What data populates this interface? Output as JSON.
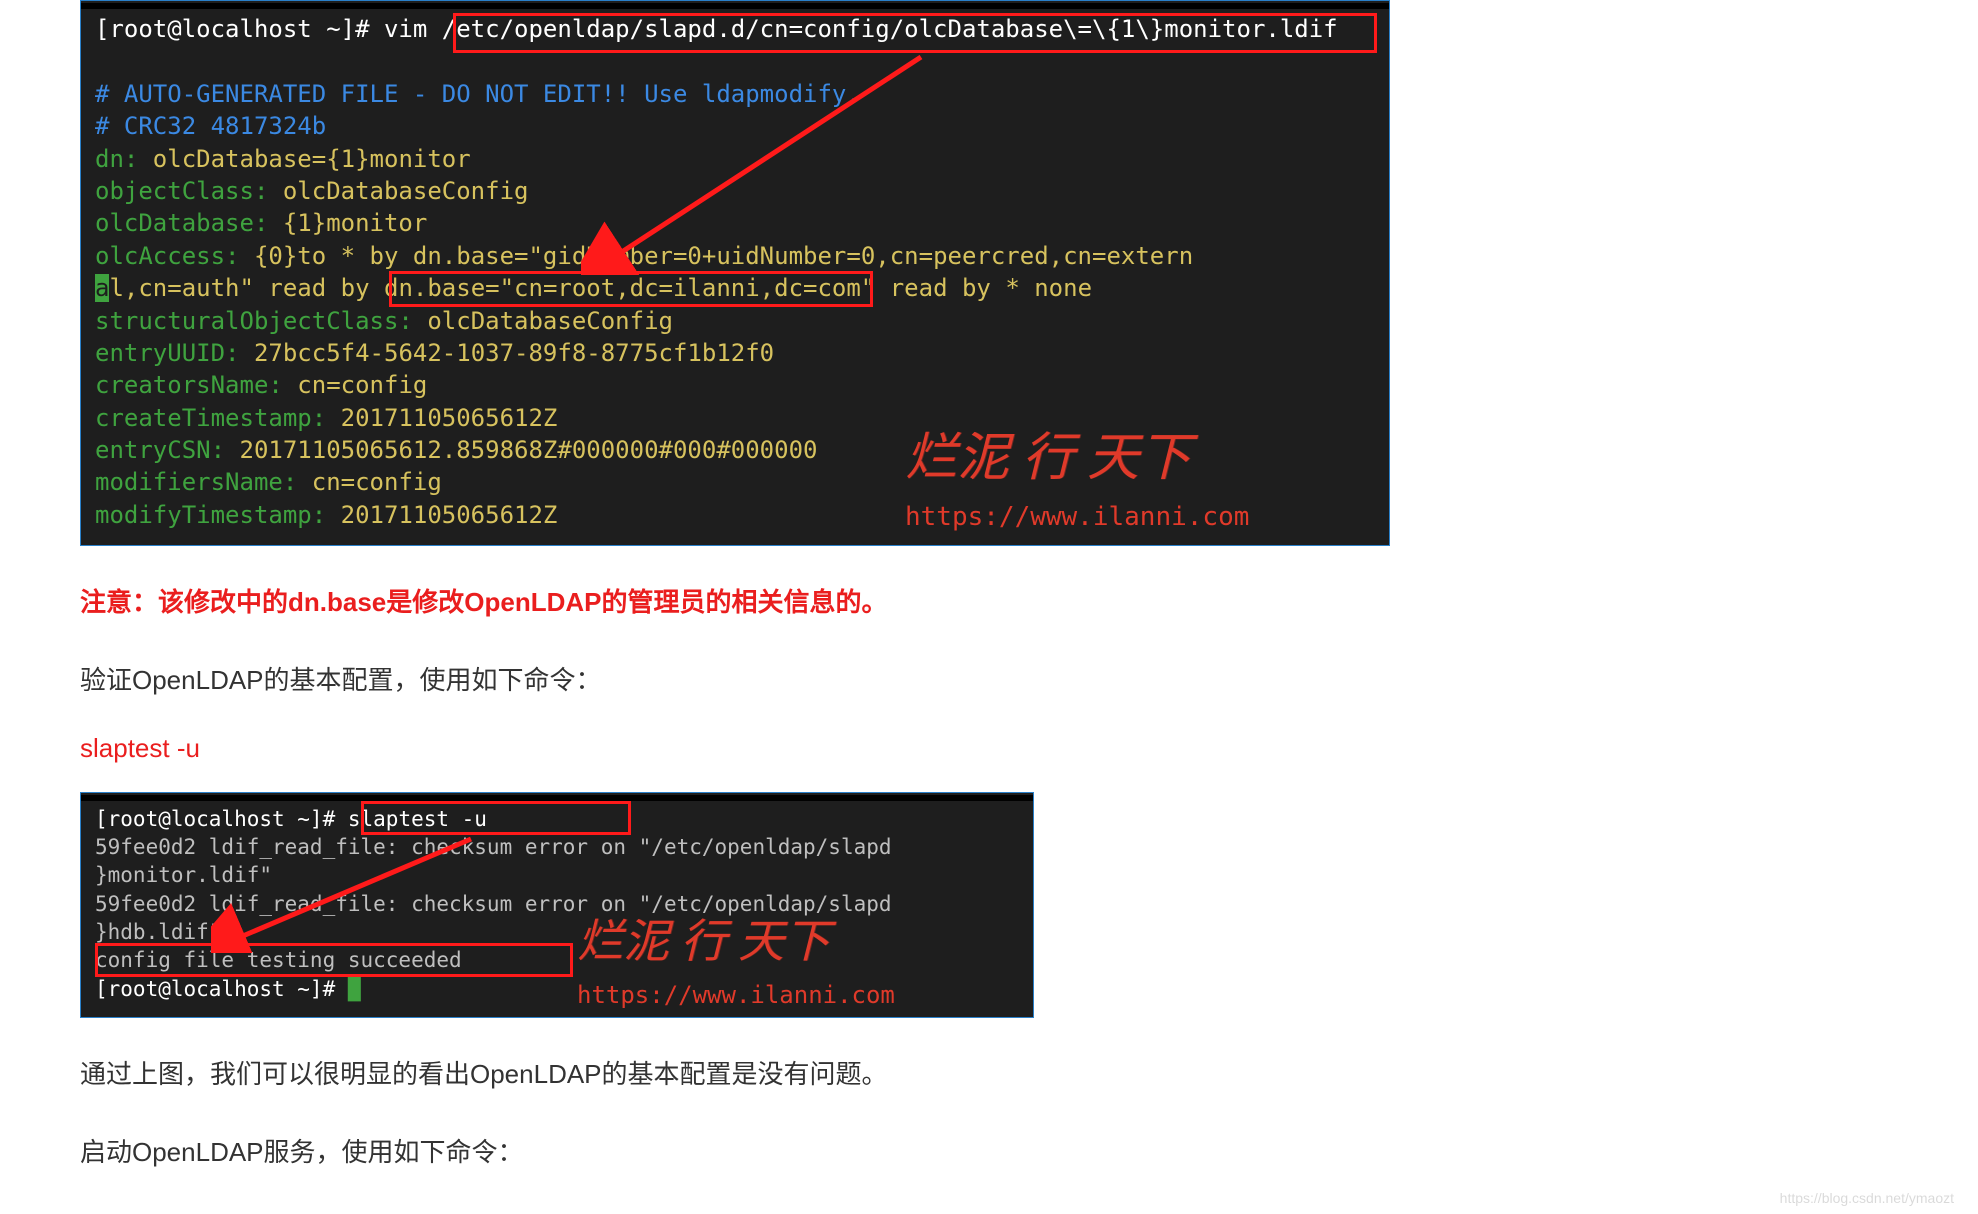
{
  "term1": {
    "l1_prompt": "[root@localhost ~]# ",
    "l1_cmd": "vim /etc/openldap/slapd.d/cn=config/olcDatabase\\=\\{1\\}monitor.ldif",
    "l2": "",
    "l3": "# AUTO-GENERATED FILE - DO NOT EDIT!! Use ldapmodify.",
    "l4": "# CRC32 4817324b",
    "l5_k": "dn:",
    "l5_v": " olcDatabase={1}monitor",
    "l6_k": "objectClass:",
    "l6_v": " olcDatabaseConfig",
    "l7_k": "olcDatabase:",
    "l7_v": " {1}monitor",
    "l8_k": "olcAccess:",
    "l8_v": " {0}to * by dn.base=\"gidNumber=0+uidNumber=0,cn=peercred,cn=extern",
    "l9_hl": "a",
    "l9_rest": "l,cn=auth\" read by ",
    "l9_box": "dn.base=\"cn=root,dc=ilanni,dc=com\"",
    "l9_tail": " read by * none",
    "l10_k": "structuralObjectClass:",
    "l10_v": " olcDatabaseConfig",
    "l11_k": "entryUUID:",
    "l11_v": " 27bcc5f4-5642-1037-89f8-8775cf1b12f0",
    "l12_k": "creatorsName:",
    "l12_v": " cn=config",
    "l13_k": "createTimestamp:",
    "l13_v": " 20171105065612Z",
    "l14_k": "entryCSN:",
    "l14_v": " 20171105065612.859868Z#000000#000#000000",
    "l15_k": "modifiersName:",
    "l15_v": " cn=config",
    "l16_k": "modifyTimestamp:",
    "l16_v": " 20171105065612Z"
  },
  "watermark1": {
    "text": "烂泥 行 天下",
    "url": "https://www.ilanni.com"
  },
  "note_red": "注意：该修改中的dn.base是修改OpenLDAP的管理员的相关信息的。",
  "para_verify": "验证OpenLDAP的基本配置，使用如下命令：",
  "cmd_slaptest": "slaptest -u",
  "term2": {
    "l1_prompt": "[root@localhost ~]# ",
    "l1_cmd": "slaptest -u",
    "l2": "59fee0d2 ldif_read_file: checksum error on \"/etc/openldap/slapd",
    "l3": "}monitor.ldif\"",
    "l4": "59fee0d2 ldif_read_file: checksum error on \"/etc/openldap/slapd",
    "l5": "}hdb.ldif\"",
    "l6": "config file testing succeeded",
    "l7_prompt": "[root@localhost ~]# ",
    "l7_cursor": "█"
  },
  "watermark2": {
    "text": "烂泥 行 天下",
    "url": "https://www.ilanni.com"
  },
  "para_conclusion": "通过上图，我们可以很明显的看出OpenLDAP的基本配置是没有问题。",
  "para_start": "启动OpenLDAP服务，使用如下命令：",
  "page_wm": "https://blog.csdn.net/ymaozt"
}
